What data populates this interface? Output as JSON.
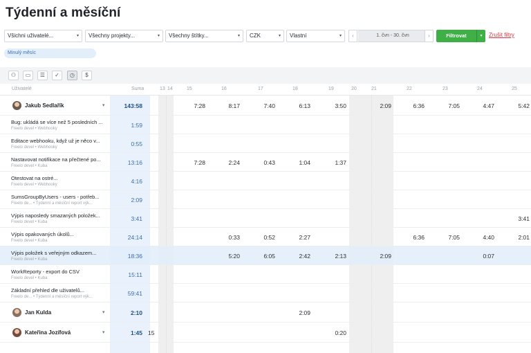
{
  "page": {
    "title": "Týdenní a měsíční"
  },
  "filters": {
    "users": "Všichni uživatelé...",
    "projects": "Všechny projekty...",
    "tags": "Všechny štítky...",
    "currency": "CZK",
    "period": "Vlastní",
    "date_range": "1. čvn - 30. čvn",
    "prev": "‹",
    "next": "›",
    "filter_button": "Filtrovat",
    "cancel_link": "Zrušit filtry",
    "caret": "▾"
  },
  "chip": {
    "label": "Minulý měsíc"
  },
  "toolbar": {
    "buttons": [
      {
        "icon": "users-icon",
        "glyph": "⚇"
      },
      {
        "icon": "folder-icon",
        "glyph": "▭"
      },
      {
        "icon": "list-icon",
        "glyph": "☰"
      },
      {
        "icon": "check-circle-icon",
        "glyph": "✓"
      },
      {
        "icon": "clock-icon",
        "glyph": "◷",
        "active": true
      },
      {
        "icon": "dollar-icon",
        "glyph": "$"
      }
    ]
  },
  "header": {
    "user_col": "Uživatelé",
    "sum_col": "Suma",
    "days": [
      "13",
      "14",
      "15",
      "16",
      "17",
      "18",
      "19",
      "20",
      "21",
      "22",
      "23",
      "24",
      "25"
    ]
  },
  "rows": [
    {
      "type": "user",
      "name": "Jakub Sedlařík",
      "sum": "143:58",
      "avatar_color": "#6b5a50",
      "values": {
        "15": "7:28",
        "16": "8:17",
        "17": "7:40",
        "18": "6:13",
        "19": "3:50",
        "21": "2:09",
        "22": "6:36",
        "23": "7:05",
        "24": "4:47",
        "25": "5:42"
      }
    },
    {
      "type": "task",
      "name": "Bug: ukládá se více než 5 posledních ...",
      "sub": "Freelo devel • Webhooky",
      "sum": "1:59",
      "values": {}
    },
    {
      "type": "task",
      "name": "Editace webhooku, když už je něco v...",
      "sub": "Freelo devel • Webhooky",
      "sum": "0:55",
      "values": {}
    },
    {
      "type": "task",
      "name": "Nastavovat notifikace na přečtené po...",
      "sub": "Freelo devel • Kuba",
      "sum": "13:16",
      "values": {
        "15": "7:28",
        "16": "2:24",
        "17": "0:43",
        "18": "1:04",
        "19": "1:37"
      }
    },
    {
      "type": "task",
      "name": "Otestovat na ostré...",
      "sub": "Freelo devel • Webhooky",
      "sum": "4:16",
      "values": {}
    },
    {
      "type": "task",
      "name": "SumsGroupByUsers - users - potřeb...",
      "sub": "Freelo de... • Týdenní a měsíční report výk...",
      "sum": "2:09",
      "values": {}
    },
    {
      "type": "task",
      "name": "Výpis naposledy smazaných položek...",
      "sub": "Freelo devel • Kuba",
      "sum": "3:41",
      "values": {
        "25": "3:41"
      }
    },
    {
      "type": "task",
      "name": "Výpis opakovaných úkolů...",
      "sub": "Freelo devel • Kuba",
      "sum": "24:14",
      "values": {
        "16": "0:33",
        "17": "0:52",
        "18": "2:27",
        "22": "6:36",
        "23": "7:05",
        "24": "4:40",
        "25": "2:01"
      }
    },
    {
      "type": "task",
      "name": "Výpis položek s veřejným odkazem...",
      "sub": "Freelo devel • Kuba",
      "sum": "18:36",
      "highlight": true,
      "values": {
        "16": "5:20",
        "17": "6:05",
        "18": "2:42",
        "19": "2:13",
        "21": "2:09",
        "24": "0:07"
      }
    },
    {
      "type": "task",
      "name": "WorkReporty - export do CSV",
      "sub": "Freelo devel • Kuba",
      "sum": "15:11",
      "values": {}
    },
    {
      "type": "task",
      "name": "Základní přehled dle uživatelů...",
      "sub": "Freelo de... • Týdenní a měsíční report výk...",
      "sum": "59:41",
      "values": {}
    },
    {
      "type": "user",
      "name": "Jan Kulda",
      "sum": "2:10",
      "avatar_color": "#8a6e5e",
      "values": {
        "18": "2:09"
      }
    },
    {
      "type": "user",
      "name": "Kateřina Jozífová",
      "sum": "1:45",
      "avatar_color": "#7a4a3e",
      "values": {
        "19": "0:20"
      },
      "overflow": "15"
    }
  ]
}
